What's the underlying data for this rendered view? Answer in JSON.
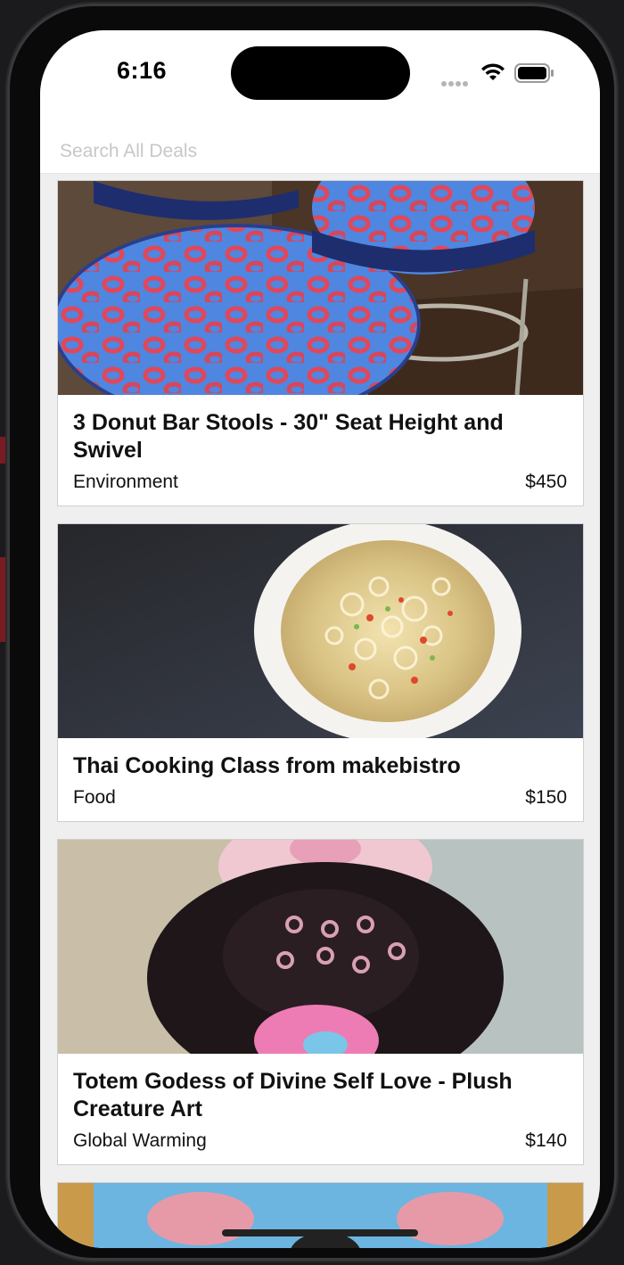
{
  "status_bar": {
    "time": "6:16"
  },
  "search": {
    "placeholder": "Search All Deals",
    "value": ""
  },
  "deals": [
    {
      "title": "3 Donut Bar Stools - 30\" Seat Height and Swivel",
      "category": "Environment",
      "price": "$450"
    },
    {
      "title": "Thai Cooking Class from makebistro",
      "category": "Food",
      "price": "$150"
    },
    {
      "title": "Totem Godess of Divine Self Love - Plush Creature Art",
      "category": "Global Warming",
      "price": "$140"
    }
  ],
  "colors": {
    "background": "#efefef",
    "card": "#ffffff",
    "placeholder": "#c7c7c9",
    "text": "#111111"
  }
}
